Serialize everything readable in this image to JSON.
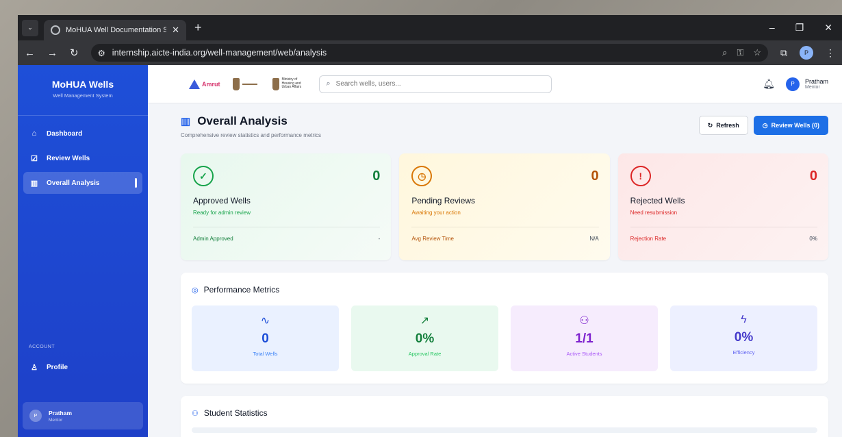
{
  "browser": {
    "tab_title": "MoHUA Well Documentation S",
    "url": "internship.aicte-india.org/well-management/web/analysis",
    "profile_initial": "P"
  },
  "sidebar": {
    "brand_name": "MoHUA Wells",
    "brand_sub": "Well Management System",
    "items": [
      {
        "label": "Dashboard",
        "icon": "home-icon"
      },
      {
        "label": "Review Wells",
        "icon": "checkbox-icon"
      },
      {
        "label": "Overall Analysis",
        "icon": "bar-chart-icon"
      }
    ],
    "account_label": "ACCOUNT",
    "profile_label": "Profile",
    "user_initial": "P",
    "user_name": "Pratham",
    "user_role": "Mentor"
  },
  "topbar": {
    "logo_amrut": "Amrut",
    "ministry_text": "Ministry of Housing and Urban Affairs",
    "search_placeholder": "Search wells, users...",
    "user_initial": "P",
    "user_name": "Pratham",
    "user_role": "Mentor"
  },
  "page": {
    "title": "Overall Analysis",
    "subtitle": "Comprehensive review statistics and performance metrics",
    "refresh_label": "Refresh",
    "review_label": "Review Wells (0)"
  },
  "stats": [
    {
      "value": "0",
      "label": "Approved Wells",
      "desc": "Ready for admin review",
      "foot_key": "Admin Approved",
      "foot_val": "-",
      "color": "#16a34a"
    },
    {
      "value": "0",
      "label": "Pending Reviews",
      "desc": "Awaiting your action",
      "foot_key": "Avg Review Time",
      "foot_val": "N/A",
      "color": "#d97706"
    },
    {
      "value": "0",
      "label": "Rejected Wells",
      "desc": "Need resubmission",
      "foot_key": "Rejection Rate",
      "foot_val": "0%",
      "color": "#dc2626"
    }
  ],
  "performance": {
    "title": "Performance Metrics",
    "metrics": [
      {
        "value": "0",
        "label": "Total Wells",
        "icon": "activity-icon"
      },
      {
        "value": "0%",
        "label": "Approval Rate",
        "icon": "trending-up-icon"
      },
      {
        "value": "1/1",
        "label": "Active Students",
        "icon": "users-icon"
      },
      {
        "value": "0%",
        "label": "Efficiency",
        "icon": "zap-icon"
      }
    ]
  },
  "students": {
    "title": "Student Statistics"
  }
}
